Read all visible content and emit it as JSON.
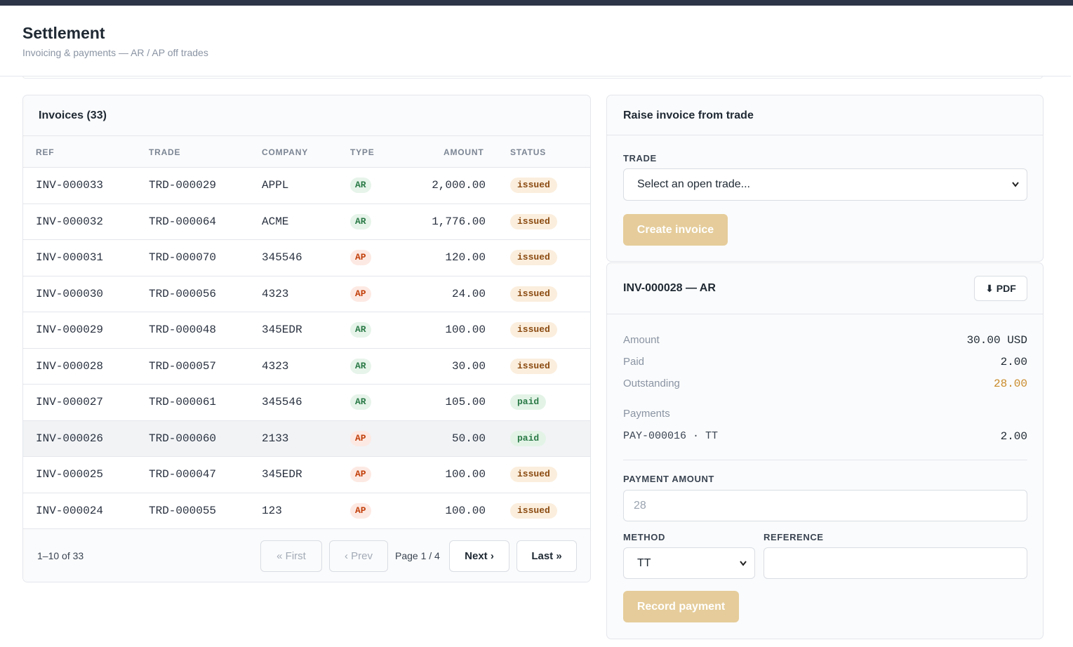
{
  "header": {
    "title": "Settlement",
    "subtitle": "Invoicing & payments — AR / AP off trades"
  },
  "invoices": {
    "title": "Invoices (33)",
    "columns": [
      "REF",
      "TRADE",
      "COMPANY",
      "TYPE",
      "AMOUNT",
      "STATUS"
    ],
    "rows": [
      {
        "ref": "INV-000033",
        "trade": "TRD-000029",
        "company": "APPL",
        "type": "AR",
        "amount": "2,000.00",
        "status": "issued"
      },
      {
        "ref": "INV-000032",
        "trade": "TRD-000064",
        "company": "ACME",
        "type": "AR",
        "amount": "1,776.00",
        "status": "issued"
      },
      {
        "ref": "INV-000031",
        "trade": "TRD-000070",
        "company": "345546",
        "type": "AP",
        "amount": "120.00",
        "status": "issued"
      },
      {
        "ref": "INV-000030",
        "trade": "TRD-000056",
        "company": "4323",
        "type": "AP",
        "amount": "24.00",
        "status": "issued"
      },
      {
        "ref": "INV-000029",
        "trade": "TRD-000048",
        "company": "345EDR",
        "type": "AR",
        "amount": "100.00",
        "status": "issued"
      },
      {
        "ref": "INV-000028",
        "trade": "TRD-000057",
        "company": "4323",
        "type": "AR",
        "amount": "30.00",
        "status": "issued"
      },
      {
        "ref": "INV-000027",
        "trade": "TRD-000061",
        "company": "345546",
        "type": "AR",
        "amount": "105.00",
        "status": "paid"
      },
      {
        "ref": "INV-000026",
        "trade": "TRD-000060",
        "company": "2133",
        "type": "AP",
        "amount": "50.00",
        "status": "paid"
      },
      {
        "ref": "INV-000025",
        "trade": "TRD-000047",
        "company": "345EDR",
        "type": "AP",
        "amount": "100.00",
        "status": "issued"
      },
      {
        "ref": "INV-000024",
        "trade": "TRD-000055",
        "company": "123",
        "type": "AP",
        "amount": "100.00",
        "status": "issued"
      }
    ],
    "pager": {
      "range": "1–10 of 33",
      "first": "« First",
      "prev": "‹ Prev",
      "page": "Page 1 / 4",
      "next": "Next ›",
      "last": "Last »"
    }
  },
  "raise": {
    "title": "Raise invoice from trade",
    "trade_label": "TRADE",
    "trade_select": "Select an open trade...",
    "create_button": "Create invoice"
  },
  "detail": {
    "title": "INV-000028 — AR",
    "pdf_button": "⬇ PDF",
    "amount_label": "Amount",
    "amount_value": "30.00 USD",
    "paid_label": "Paid",
    "paid_value": "2.00",
    "outstanding_label": "Outstanding",
    "outstanding_value": "28.00",
    "payments_label": "Payments",
    "payments": [
      {
        "id": "PAY-000016 · TT",
        "amount": "2.00"
      }
    ],
    "payment_amount_label": "PAYMENT AMOUNT",
    "payment_amount_placeholder": "28",
    "method_label": "METHOD",
    "method_value": "TT",
    "reference_label": "REFERENCE",
    "reference_value": "",
    "record_button": "Record payment"
  },
  "colors": {
    "accent_gold": "#e5cc9a",
    "ar_pill": "#e6f4ea",
    "ap_pill": "#fde9e3",
    "issued_pill": "#fbeedd",
    "outstanding": "#c98a2a"
  }
}
